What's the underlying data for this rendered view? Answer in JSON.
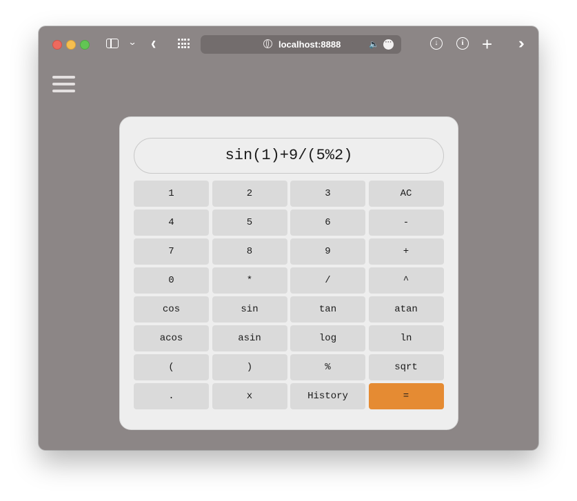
{
  "browser": {
    "url": "localhost:8888"
  },
  "calculator": {
    "display": "sin(1)+9/(5%2)",
    "keys": [
      {
        "label": "1"
      },
      {
        "label": "2"
      },
      {
        "label": "3"
      },
      {
        "label": "AC"
      },
      {
        "label": "4"
      },
      {
        "label": "5"
      },
      {
        "label": "6"
      },
      {
        "label": "-"
      },
      {
        "label": "7"
      },
      {
        "label": "8"
      },
      {
        "label": "9"
      },
      {
        "label": "+"
      },
      {
        "label": "0"
      },
      {
        "label": "*"
      },
      {
        "label": "/"
      },
      {
        "label": "^"
      },
      {
        "label": "cos"
      },
      {
        "label": "sin"
      },
      {
        "label": "tan"
      },
      {
        "label": "atan"
      },
      {
        "label": "acos"
      },
      {
        "label": "asin"
      },
      {
        "label": "log"
      },
      {
        "label": "ln"
      },
      {
        "label": "("
      },
      {
        "label": ")"
      },
      {
        "label": "%"
      },
      {
        "label": "sqrt"
      },
      {
        "label": "."
      },
      {
        "label": "x"
      },
      {
        "label": "History"
      },
      {
        "label": "="
      }
    ],
    "accent_color": "#e58b33"
  },
  "icons": {
    "sidebar": "sidebar-icon",
    "chevron": "chevron-down-icon",
    "back": "back-arrow-icon",
    "tabs": "tab-overview-icon",
    "site": "globe-icon",
    "audio": "speaker-icon",
    "page_menu": "more-icon",
    "download": "download-icon",
    "info": "info-icon",
    "new_tab": "plus-icon",
    "overflow": "double-chevron-icon",
    "menu": "hamburger-menu-icon"
  }
}
